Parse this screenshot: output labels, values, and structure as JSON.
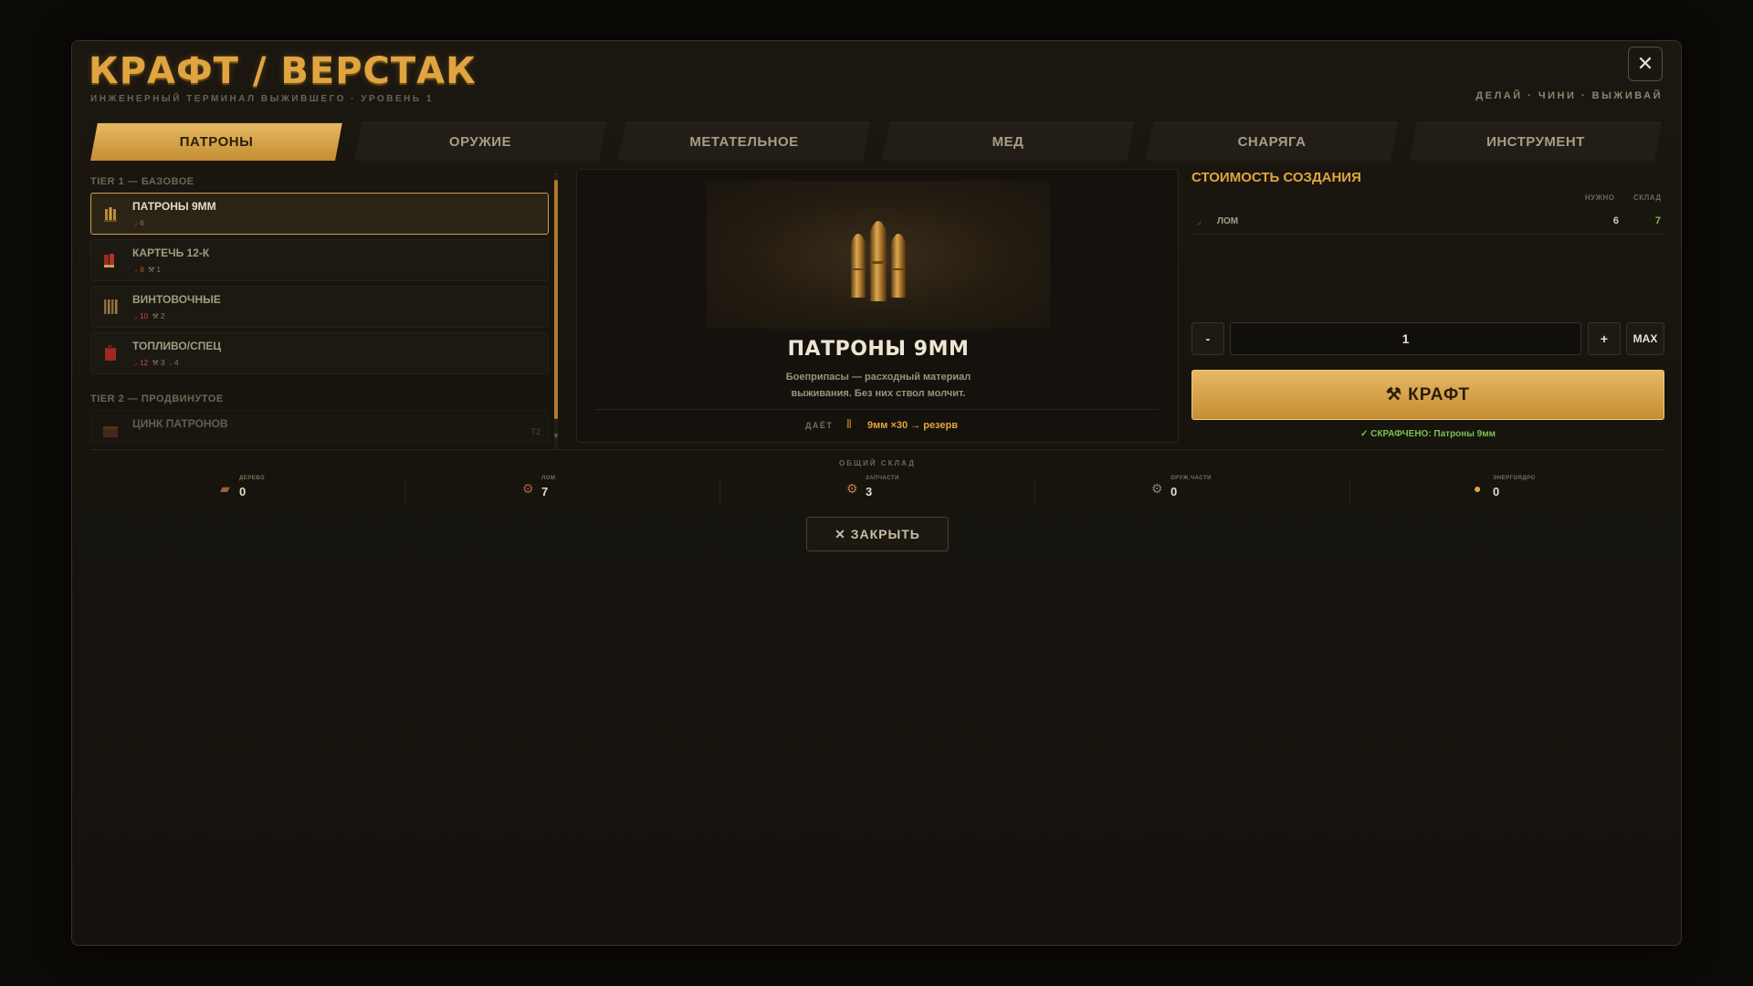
{
  "header": {
    "title": "КРАФТ / ВЕРСТАК",
    "subtitle": "ИНЖЕНЕРНЫЙ ТЕРМИНАЛ ВЫЖИВШЕГО · УРОВЕНЬ 1",
    "motto": "ДЕЛАЙ · ЧИНИ · ВЫЖИВАЙ",
    "close_icon": "✕"
  },
  "tabs": [
    {
      "label": "ПАТРОНЫ",
      "active": true
    },
    {
      "label": "ОРУЖИЕ",
      "active": false
    },
    {
      "label": "МЕТАТЕЛЬНОЕ",
      "active": false
    },
    {
      "label": "МЕД",
      "active": false
    },
    {
      "label": "СНАРЯГА",
      "active": false
    },
    {
      "label": "ИНСТРУМЕНТ",
      "active": false
    }
  ],
  "recipes": {
    "tier1_label": "TIER 1 — БАЗОВОЕ",
    "tier2_label": "TIER 2 — ПРОДВИНУТОЕ",
    "items": [
      {
        "name": "ПАТРОНЫ 9ММ",
        "cost": [
          "6"
        ],
        "icon": "bullets-icon",
        "selected": true
      },
      {
        "name": "КАРТЕЧЬ 12-К",
        "cost": [
          "8",
          "1"
        ],
        "icon": "shells-icon",
        "selected": false
      },
      {
        "name": "ВИНТОВОЧНЫЕ",
        "cost": [
          "10",
          "2"
        ],
        "icon": "rifle-rounds-icon",
        "selected": false
      },
      {
        "name": "ТОПЛИВО/СПЕЦ",
        "cost": [
          "12",
          "3",
          "4"
        ],
        "icon": "fuel-can-icon",
        "selected": false
      }
    ],
    "locked_item": {
      "name": "ЦИНК ПАТРОНОВ",
      "level": "Т2",
      "icon": "ammo-crate-icon"
    }
  },
  "preview": {
    "name": "ПАТРОНЫ 9ММ",
    "desc_line1": "Боеприпасы — расходный материал",
    "desc_line2": "выживания. Без них ствол молчит.",
    "yields_label": "ДАЁТ",
    "yields_value": "9мм ×30 → резерв",
    "image_icon": "bullets-icon"
  },
  "cost": {
    "title": "СТОИМОСТЬ СОЗДАНИЯ",
    "col_need": "НУЖНО",
    "col_have": "СКЛАД",
    "rows": [
      {
        "name": "ЛОМ",
        "need": "6",
        "have": "7",
        "icon": "scrap-icon"
      }
    ]
  },
  "quantity": {
    "minus": "-",
    "value": "1",
    "plus": "+",
    "max": "MAX"
  },
  "craft": {
    "label": "⚒ КРАФТ",
    "status": "✓ СКРАФЧЕНО: Патроны 9мм"
  },
  "storage": {
    "label": "ОБЩИЙ СКЛАД",
    "items": [
      {
        "label": "ДЕРЕВО",
        "value": "0",
        "icon": "wood-icon"
      },
      {
        "label": "ЛОМ",
        "value": "7",
        "icon": "scrap-icon"
      },
      {
        "label": "ЗАПЧАСТИ",
        "value": "3",
        "icon": "gear-parts-icon"
      },
      {
        "label": "ОРУЖ.ЧАСТИ",
        "value": "0",
        "icon": "weapon-parts-icon"
      },
      {
        "label": "ЭНЕРГОЯДРО",
        "value": "0",
        "icon": "energy-core-icon"
      }
    ]
  },
  "footer": {
    "close_label": "✕ ЗАКРЫТЬ"
  },
  "colors": {
    "accent": "#e0a540",
    "success": "#7cc050",
    "background": "#17140e"
  }
}
